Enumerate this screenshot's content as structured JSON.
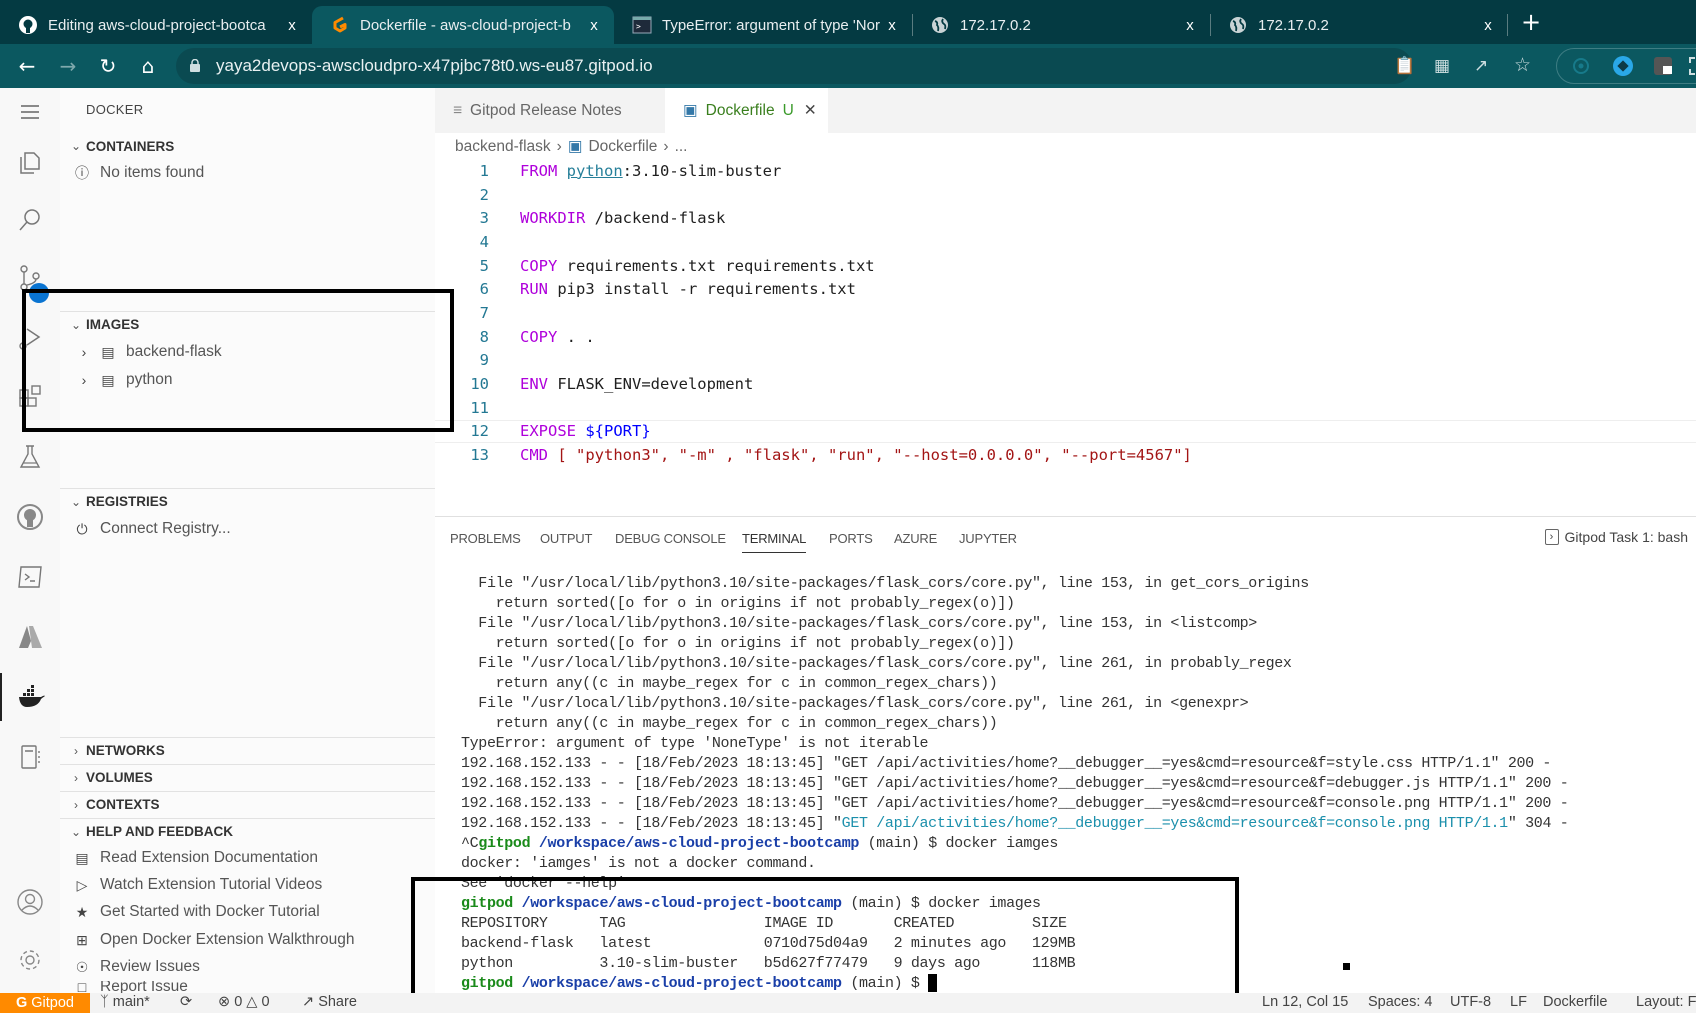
{
  "browser": {
    "tabs": [
      {
        "label": "Editing aws-cloud-project-bootca",
        "icon": "github-icon",
        "active": false
      },
      {
        "label": "Dockerfile - aws-cloud-project-b",
        "icon": "gitpod-icon",
        "active": true
      },
      {
        "label": "TypeError: argument of type 'Nor",
        "icon": "terminal-app-icon",
        "active": false
      },
      {
        "label": "172.17.0.2",
        "icon": "globe-icon",
        "active": false
      },
      {
        "label": "172.17.0.2",
        "icon": "globe-icon",
        "active": false
      }
    ],
    "new_tab": "+",
    "url": "yaya2devops-awscloudpro-x47pjbc78t0.ws-eu87.gitpod.io",
    "close_glyph": "x"
  },
  "sidebar": {
    "title": "DOCKER",
    "sections": {
      "containers": {
        "label": "CONTAINERS",
        "empty": "No items found"
      },
      "images": {
        "label": "IMAGES",
        "items": [
          "backend-flask",
          "python"
        ]
      },
      "registries": {
        "label": "REGISTRIES",
        "action": "Connect Registry..."
      },
      "networks": {
        "label": "NETWORKS"
      },
      "volumes": {
        "label": "VOLUMES"
      },
      "contexts": {
        "label": "CONTEXTS"
      },
      "help": {
        "label": "HELP AND FEEDBACK",
        "items": [
          "Read Extension Documentation",
          "Watch Extension Tutorial Videos",
          "Get Started with Docker Tutorial",
          "Open Docker Extension Walkthrough",
          "Review Issues",
          "Report Issue"
        ]
      }
    }
  },
  "editor": {
    "tabs": [
      {
        "label": "Gitpod Release Notes"
      },
      {
        "label": "Dockerfile",
        "status": "U"
      }
    ],
    "breadcrumb": [
      "backend-flask",
      "Dockerfile",
      "..."
    ],
    "lines": [
      {
        "n": "1",
        "kw": "FROM",
        "rest": ":3.10-slim-buster",
        "link": "python"
      },
      {
        "n": "2"
      },
      {
        "n": "3",
        "kw": "WORKDIR",
        "rest": " /backend-flask"
      },
      {
        "n": "4"
      },
      {
        "n": "5",
        "kw": "COPY",
        "rest": " requirements.txt requirements.txt"
      },
      {
        "n": "6",
        "kw": "RUN",
        "rest": " pip3 install -r requirements.txt"
      },
      {
        "n": "7"
      },
      {
        "n": "8",
        "kw": "COPY",
        "rest": " . ."
      },
      {
        "n": "9"
      },
      {
        "n": "10",
        "kw": "ENV",
        "rest": " FLASK_ENV=development"
      },
      {
        "n": "11"
      },
      {
        "n": "12",
        "kw": "EXPOSE",
        "rest": " ${PORT}"
      },
      {
        "n": "13",
        "kw": "CMD",
        "rest": " [ \"python3\", \"-m\" , \"flask\", \"run\", \"--host=0.0.0.0\", \"--port=4567\"]"
      }
    ]
  },
  "panel": {
    "tabs": [
      "PROBLEMS",
      "OUTPUT",
      "DEBUG CONSOLE",
      "TERMINAL",
      "PORTS",
      "AZURE",
      "JUPYTER"
    ],
    "active_tab": "TERMINAL",
    "task": "Gitpod Task 1: bash",
    "terminal": {
      "traceback": [
        "  File \"/usr/local/lib/python3.10/site-packages/flask_cors/core.py\", line 153, in get_cors_origins",
        "    return sorted([o for o in origins if not probably_regex(o)])",
        "  File \"/usr/local/lib/python3.10/site-packages/flask_cors/core.py\", line 153, in <listcomp>",
        "    return sorted([o for o in origins if not probably_regex(o)])",
        "  File \"/usr/local/lib/python3.10/site-packages/flask_cors/core.py\", line 261, in probably_regex",
        "    return any((c in maybe_regex for c in common_regex_chars))",
        "  File \"/usr/local/lib/python3.10/site-packages/flask_cors/core.py\", line 261, in <genexpr>",
        "    return any((c in maybe_regex for c in common_regex_chars))",
        "TypeError: argument of type 'NoneType' is not iterable",
        "192.168.152.133 - - [18/Feb/2023 18:13:45] \"GET /api/activities/home?__debugger__=yes&cmd=resource&f=style.css HTTP/1.1\" 200 -",
        "192.168.152.133 - - [18/Feb/2023 18:13:45] \"GET /api/activities/home?__debugger__=yes&cmd=resource&f=debugger.js HTTP/1.1\" 200 -",
        "192.168.152.133 - - [18/Feb/2023 18:13:45] \"GET /api/activities/home?__debugger__=yes&cmd=resource&f=console.png HTTP/1.1\" 200 -"
      ],
      "log304": {
        "prefix": "192.168.152.133 - - [18/Feb/2023 18:13:45] \"",
        "request": "GET /api/activities/home?__debugger__=yes&cmd=resource&f=console.png HTTP/1.1",
        "suffix": "\" 304 -"
      },
      "prompt_user": "gitpod",
      "prompt_path": "/workspace/aws-cloud-project-bootcamp",
      "prompt_branch": " (main) $ ",
      "ctrl_c": "^C",
      "cmd1": "docker iamges",
      "err1": "docker: 'iamges' is not a docker command.",
      "err2": "See 'docker --help'",
      "cmd2": "docker images",
      "table_header": "REPOSITORY      TAG                IMAGE ID       CREATED         SIZE",
      "images": [
        {
          "repository": "backend-flask",
          "tag": "latest",
          "image_id": "0710d75d04a9",
          "created": "2 minutes ago",
          "size": "129MB"
        },
        {
          "repository": "python",
          "tag": "3.10-slim-buster",
          "image_id": "b5d627f77479",
          "created": "9 days ago",
          "size": "118MB"
        }
      ],
      "row1": "backend-flask   latest             0710d75d04a9   2 minutes ago   129MB",
      "row2": "python          3.10-slim-buster   b5d627f77479   9 days ago      118MB"
    }
  },
  "statusbar": {
    "gitpod": "Gitpod",
    "branch": "main*",
    "errors": "0",
    "warnings": "0",
    "share": "Share",
    "position": "Ln 12, Col 15",
    "spaces": "Spaces: 4",
    "encoding": "UTF-8",
    "eol": "LF",
    "language": "Dockerfile",
    "layout": "Layout: Fr"
  },
  "colors": {
    "tabbar": "#043a42",
    "toolbar": "#0b5860",
    "gitpod_orange": "#ff8a00",
    "keyword": "#af00db",
    "prompt_green": "#1a8a1a",
    "prompt_path": "#1a3fa8"
  }
}
